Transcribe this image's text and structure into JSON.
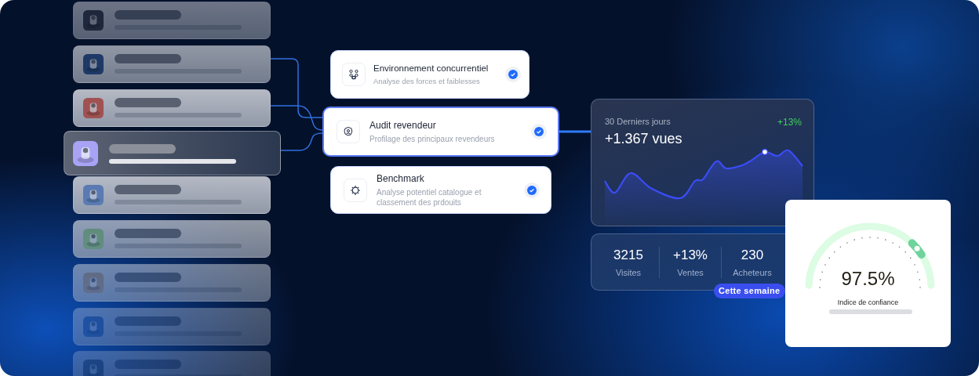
{
  "products": [
    {
      "selected": false
    },
    {
      "selected": false
    },
    {
      "selected": false
    },
    {
      "selected": true
    },
    {
      "selected": false
    },
    {
      "selected": false
    },
    {
      "selected": false
    },
    {
      "selected": false
    },
    {
      "selected": false
    }
  ],
  "tasks": [
    {
      "title": "Environnement concurrentiel",
      "subtitle": "Analyse des forces et faiblesses",
      "kind": "people",
      "checked": true,
      "selected": false
    },
    {
      "title": "Audit revendeur",
      "subtitle": "Profilage des principaux revendeurs",
      "kind": "profile",
      "checked": true,
      "selected": true
    },
    {
      "title": "Benchmark",
      "subtitle": "Analyse potentiel catalogue et classement des prdouits",
      "kind": "gear",
      "checked": true,
      "selected": false
    }
  ],
  "views": {
    "period": "30 Derniers jours",
    "value": "+1.367 vues",
    "change": "+13%"
  },
  "stats": [
    {
      "value": "3215",
      "label": "Visites"
    },
    {
      "value": "+13%",
      "label": "Ventes"
    },
    {
      "value": "230",
      "label": "Acheteurs"
    }
  ],
  "badge": "Cette semaine",
  "gauge": {
    "value": "97.5%",
    "label": "Indice de confiance",
    "level": 0.78
  }
}
